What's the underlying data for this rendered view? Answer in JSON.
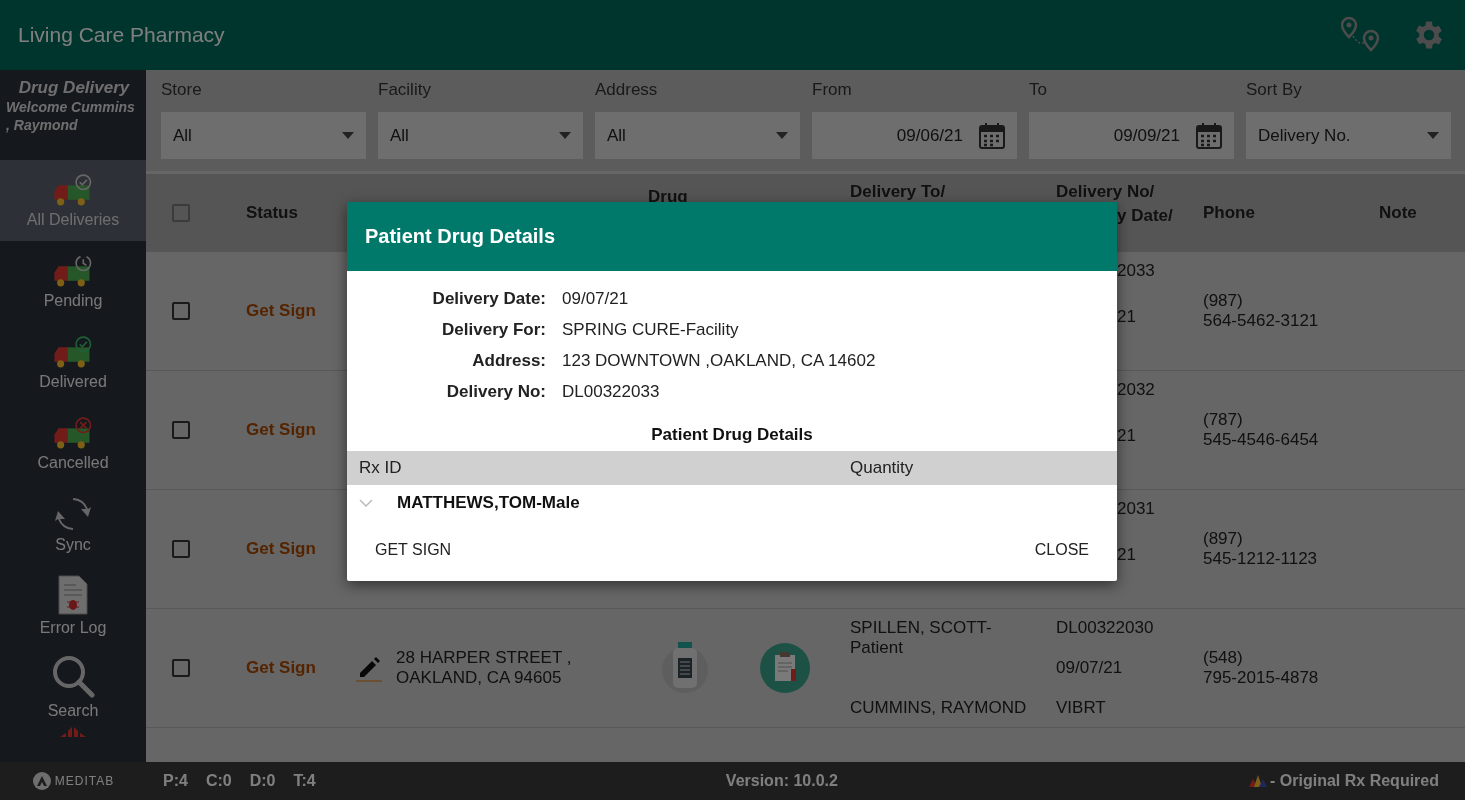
{
  "app_bar": {
    "title": "Living Care Pharmacy"
  },
  "sidebar": {
    "title": "Drug Delivery",
    "welcome": "Welcome Cummins , Raymond",
    "brand": "MEDITAB",
    "items": [
      {
        "label": "All Deliveries",
        "kind": "all",
        "selected": true
      },
      {
        "label": "Pending",
        "kind": "pending",
        "selected": false
      },
      {
        "label": "Delivered",
        "kind": "delivered",
        "selected": false
      },
      {
        "label": "Cancelled",
        "kind": "cancelled",
        "selected": false
      },
      {
        "label": "Sync",
        "kind": "sync",
        "selected": false
      },
      {
        "label": "Error Log",
        "kind": "errorlog",
        "selected": false
      },
      {
        "label": "Search",
        "kind": "search",
        "selected": false
      }
    ]
  },
  "filters": [
    {
      "label": "Store",
      "kind": "dropdown",
      "value": "All"
    },
    {
      "label": "Facility",
      "kind": "dropdown",
      "value": "All"
    },
    {
      "label": "Address",
      "kind": "dropdown",
      "value": "All"
    },
    {
      "label": "From",
      "kind": "date",
      "value": "09/06/21"
    },
    {
      "label": "To",
      "kind": "date",
      "value": "09/09/21"
    },
    {
      "label": "Sort By",
      "kind": "dropdown",
      "value": "Delivery No."
    }
  ],
  "table": {
    "header": {
      "checked": false,
      "status": "Status",
      "drug": "Drug",
      "delivery_to": "Delivery To/",
      "delivery_no": "Delivery No/",
      "delivery_date": "y Date/",
      "phone": "Phone",
      "note": "Note"
    },
    "rows": [
      {
        "kind": "under-dialog",
        "checked": false,
        "status": "Get Sign",
        "delivery_no": "2033",
        "delivery_date": "21",
        "phone": [
          "(987)",
          "564-5462-3121"
        ]
      },
      {
        "kind": "under-dialog",
        "checked": false,
        "status": "Get Sign",
        "delivery_no": "2032",
        "delivery_date": "21",
        "phone": [
          "(787)",
          "545-4546-6454"
        ]
      },
      {
        "kind": "under-dialog",
        "checked": false,
        "status": "Get Sign",
        "delivery_no": "2031",
        "delivery_date": "21",
        "phone": [
          "(897)",
          "545-1212-1123"
        ]
      },
      {
        "kind": "full",
        "checked": false,
        "status": "Get Sign",
        "address": [
          "28 HARPER STREET ,",
          "OAKLAND, CA 94605"
        ],
        "delivery_to": "SPILLEN, SCOTT-Patient",
        "delivered_by": "CUMMINS, RAYMOND",
        "delivery_no": "DL00322030",
        "delivery_date": "09/07/21",
        "carrier": "VIBRT",
        "phone": [
          "(548)",
          "795-2015-4878"
        ]
      }
    ]
  },
  "status_bar": {
    "counts": [
      "P:4",
      "C:0",
      "D:0",
      "T:4"
    ],
    "version": "Version: 10.0.2",
    "legend": "- Original Rx Required"
  },
  "dialog": {
    "title": "Patient Drug Details",
    "fields": [
      {
        "label": "Delivery Date:",
        "value": "09/07/21"
      },
      {
        "label": "Delivery For:",
        "value": "SPRING CURE-Facility"
      },
      {
        "label": "Address:",
        "value": "123 DOWNTOWN ,OAKLAND, CA 14602"
      },
      {
        "label": "Delivery No:",
        "value": "DL00322033"
      }
    ],
    "section_title": "Patient Drug Details",
    "columns": [
      "Rx ID",
      "Quantity"
    ],
    "groups": [
      {
        "name": "MATTHEWS,TOM-Male",
        "expanded": false
      }
    ],
    "buttons": [
      "GET SIGN",
      "CLOSE"
    ]
  }
}
